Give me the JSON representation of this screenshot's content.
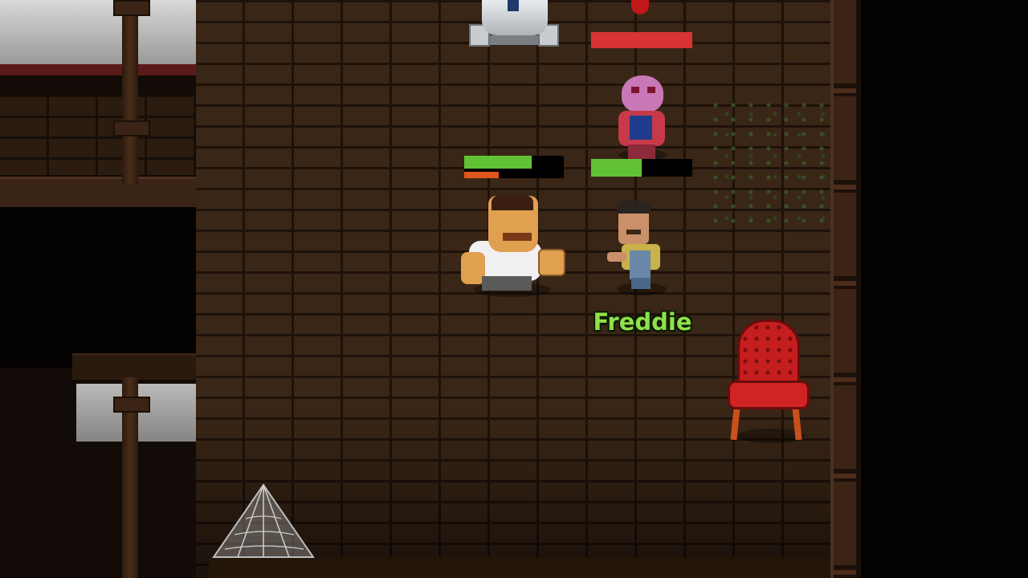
{
  "game": {
    "player_name_label": "Freddie",
    "colors": {
      "floor": "#3a2616",
      "health_green": "#62c236",
      "health_red": "#d83434",
      "stamina_orange": "#e0561c",
      "name_label": "#8fe04a"
    },
    "characters": [
      {
        "id": "robot",
        "icon": "droid-robot-icon"
      },
      {
        "id": "zombie",
        "icon": "pink-zombie-icon"
      },
      {
        "id": "brute",
        "icon": "brawler-icon"
      },
      {
        "id": "freddie",
        "icon": "freddie-icon"
      }
    ],
    "health_bars": {
      "enemy_top": {
        "health": 1.0,
        "color": "#d83434"
      },
      "brute": {
        "health": 0.68,
        "stamina": 0.35
      },
      "zombie": {
        "health": 0.5
      }
    },
    "props": [
      "red-armchair-icon",
      "spider-web-icon",
      "moss-icon"
    ]
  }
}
